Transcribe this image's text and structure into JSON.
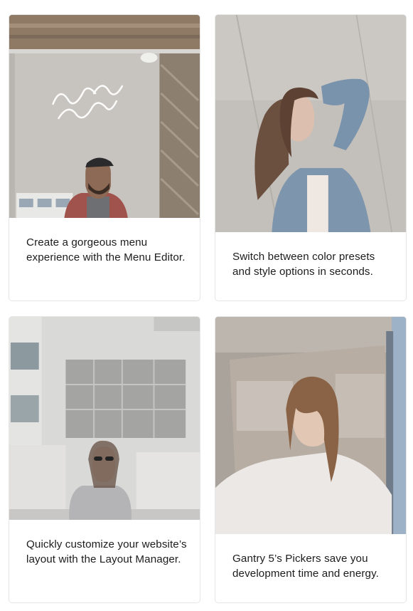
{
  "cards": [
    {
      "image_alt": "coffee shop barista photo",
      "caption": "Create a gorgeous menu experience with the Menu Editor."
    },
    {
      "image_alt": "woman in denim jacket photo",
      "caption": "Switch between color presets and style options in seconds."
    },
    {
      "image_alt": "woman in sweater with sunglasses photo",
      "caption": "Quickly customize your website’s layout with the Layout Manager."
    },
    {
      "image_alt": "woman in car window photo",
      "caption": "Gantry 5’s Pickers save you development time and energy."
    }
  ]
}
